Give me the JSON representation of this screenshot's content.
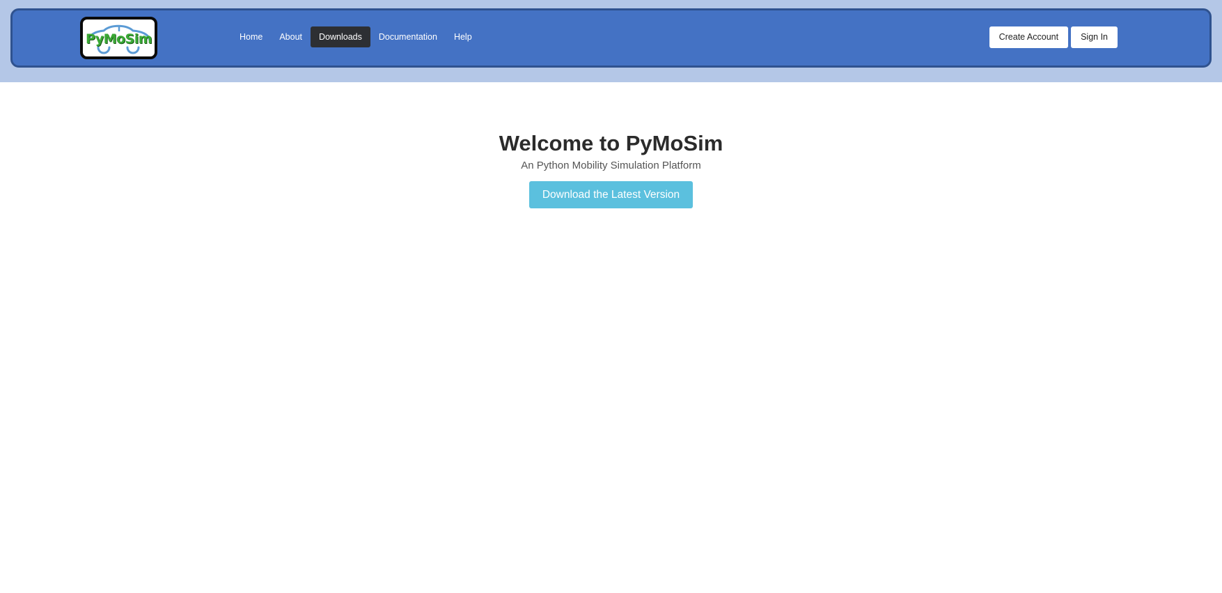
{
  "brand": {
    "logo_text": "PyMoSim",
    "logo_text_color": "#3aa935",
    "logo_car_color": "#5b9bd5"
  },
  "nav": {
    "items": [
      {
        "label": "Home",
        "active": false
      },
      {
        "label": "About",
        "active": false
      },
      {
        "label": "Downloads",
        "active": true
      },
      {
        "label": "Documentation",
        "active": false
      },
      {
        "label": "Help",
        "active": false
      }
    ]
  },
  "auth": {
    "create_account_label": "Create Account",
    "sign_in_label": "Sign In"
  },
  "hero": {
    "title": "Welcome to PyMoSim",
    "subtitle": "An Python Mobility Simulation Platform",
    "button_label": "Download the Latest Version"
  },
  "colors": {
    "header_band": "#b4c7e7",
    "navbar": "#4472c4",
    "navbar_border": "#2f528f",
    "active_nav": "#2d2f33",
    "hero_button": "#5bc0de"
  }
}
